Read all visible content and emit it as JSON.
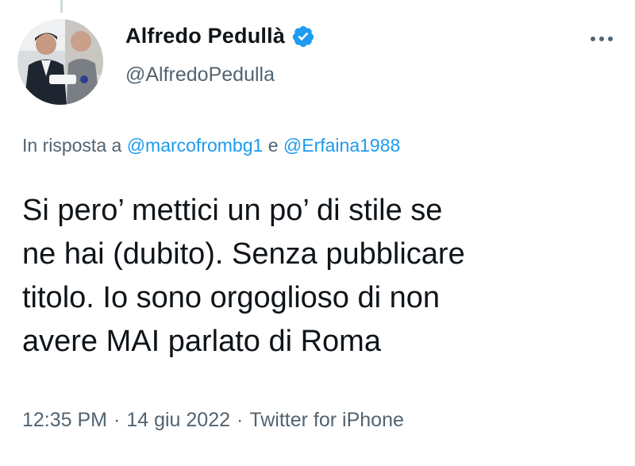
{
  "tweet": {
    "author": {
      "display_name": "Alfredo Pedullà",
      "handle": "@AlfredoPedulla",
      "verified": true,
      "verified_icon": "verified-badge-icon"
    },
    "more_icon": "more-dots-icon",
    "reply_prefix": "In risposta a",
    "reply_to": [
      "@marcofrombg1",
      "@Erfaina1988"
    ],
    "reply_conjunction": "e",
    "text_lines": [
      "Si pero’ mettici un po’ di stile se",
      "ne hai (dubito). Senza pubblicare",
      "titolo. Io sono orgoglioso di non",
      "avere MAI parlato di Roma"
    ],
    "time": "12:35 PM",
    "date": "14 giu 2022",
    "source": "Twitter for iPhone",
    "separator": "·"
  },
  "colors": {
    "text": "#0f1419",
    "secondary": "#536471",
    "link": "#1d9bf0",
    "verified": "#1d9bf0"
  }
}
